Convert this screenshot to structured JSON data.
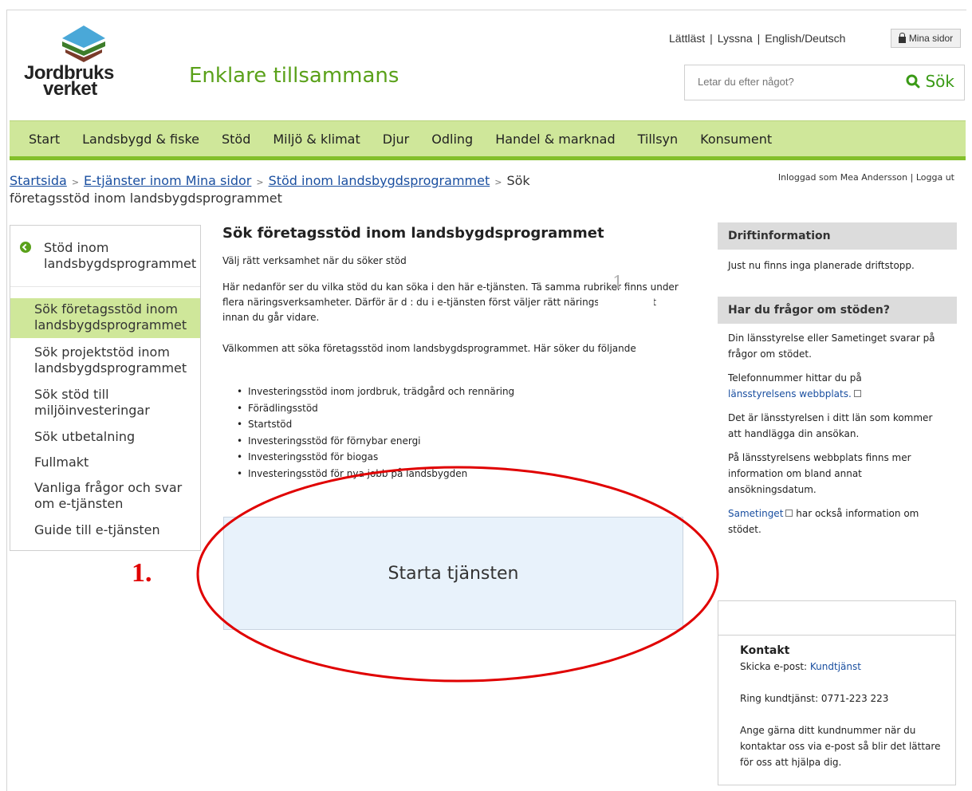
{
  "header": {
    "logo_line1": "Jordbruks",
    "logo_line2": "verket",
    "tagline": "Enklare tillsammans",
    "links": [
      "Lättläst",
      "Lyssna",
      "English/Deutsch"
    ],
    "link_separator": "|",
    "mina_sidor": "Mina sidor",
    "search_placeholder": "Letar du efter något?",
    "search_button": "Sök"
  },
  "nav": {
    "items": [
      "Start",
      "Landsbygd & fiske",
      "Stöd",
      "Miljö & klimat",
      "Djur",
      "Odling",
      "Handel & marknad",
      "Tillsyn",
      "Konsument"
    ]
  },
  "breadcrumb": {
    "items": [
      "Startsida",
      "E-tjänster inom Mina sidor",
      "Stöd inom landsbygdsprogrammet"
    ],
    "current": "Sök företagsstöd inom landsbygdsprogrammet",
    "separator": ">"
  },
  "user": {
    "logged_in": "Inloggad som Mea Andersson",
    "logout": "Logga ut"
  },
  "sidebar": {
    "back_label": "Stöd inom landsbygdsprogrammet",
    "items": [
      {
        "label": "Sök företagsstöd inom landsbygdsprogrammet",
        "active": true
      },
      {
        "label": "Sök projektstöd inom landsbygdsprogrammet",
        "active": false
      },
      {
        "label": "Sök stöd till miljöinvesteringar",
        "active": false
      },
      {
        "label": "Sök utbetalning",
        "active": false
      },
      {
        "label": "Fullmakt",
        "active": false
      },
      {
        "label": "Vanliga frågor och svar om e-tjänsten",
        "active": false
      },
      {
        "label": "Guide till e-tjänsten",
        "active": false
      }
    ]
  },
  "main": {
    "title": "Sök företagsstöd inom landsbygdsprogrammet",
    "intro": "Välj rätt verksamhet när du söker stöd",
    "para1": "Här nedanför ser du vilka stöd du kan söka i den här e-tjänsten. Tä samma rubriker finns under flera näringsverksamheter. Därför är d : du i e-tjänsten först väljer rätt näringsverksamhet innan du går vidare.",
    "para2": "Välkommen att söka företagsstöd inom landsbygdsprogrammet. Här söker du följande",
    "bullets": [
      "Investeringsstöd inom jordbruk, trädgård och rennäring",
      "Förädlingsstöd",
      "Startstöd",
      "Investeringsstöd för förnybar energi",
      "Investeringsstöd för biogas",
      "Investeringsstöd för nya jobb på landsbygden"
    ],
    "start_button": "Starta tjänsten",
    "overlay_number": "1."
  },
  "annotation": {
    "label": "1.",
    "color": "#e00000"
  },
  "right": {
    "drift": {
      "title": "Driftinformation",
      "text": "Just nu finns inga planerade driftstopp."
    },
    "faq": {
      "title": "Har du frågor om stöden?",
      "p1": "Din länsstyrelse eller Sametinget svarar på frågor om stödet.",
      "p2_text": "Telefonnummer hittar du på",
      "p2_link": "länsstyrelsens webbplats.",
      "p3": "Det är länsstyrelsen i ditt län som kommer att handlägga din ansökan.",
      "p4": "På länsstyrelsens webbplats finns mer information om bland annat ansökningsdatum.",
      "p5_link": "Sametinget",
      "p5_text": "har också information om stödet."
    },
    "contact": {
      "title": "Kontakt",
      "email_label": "Skicka e-post:",
      "email_link": "Kundtjänst",
      "phone": "Ring kundtjänst: 0771-223 223",
      "note": "Ange gärna ditt kundnummer när du kontaktar oss via e-post så blir det lättare för oss att hjälpa dig."
    }
  },
  "colors": {
    "brand_green": "#5aa11a",
    "nav_bg": "#cfe79a",
    "nav_border": "#83bf2a",
    "link": "#1a4fa0",
    "start_bg": "#e8f2fb"
  }
}
